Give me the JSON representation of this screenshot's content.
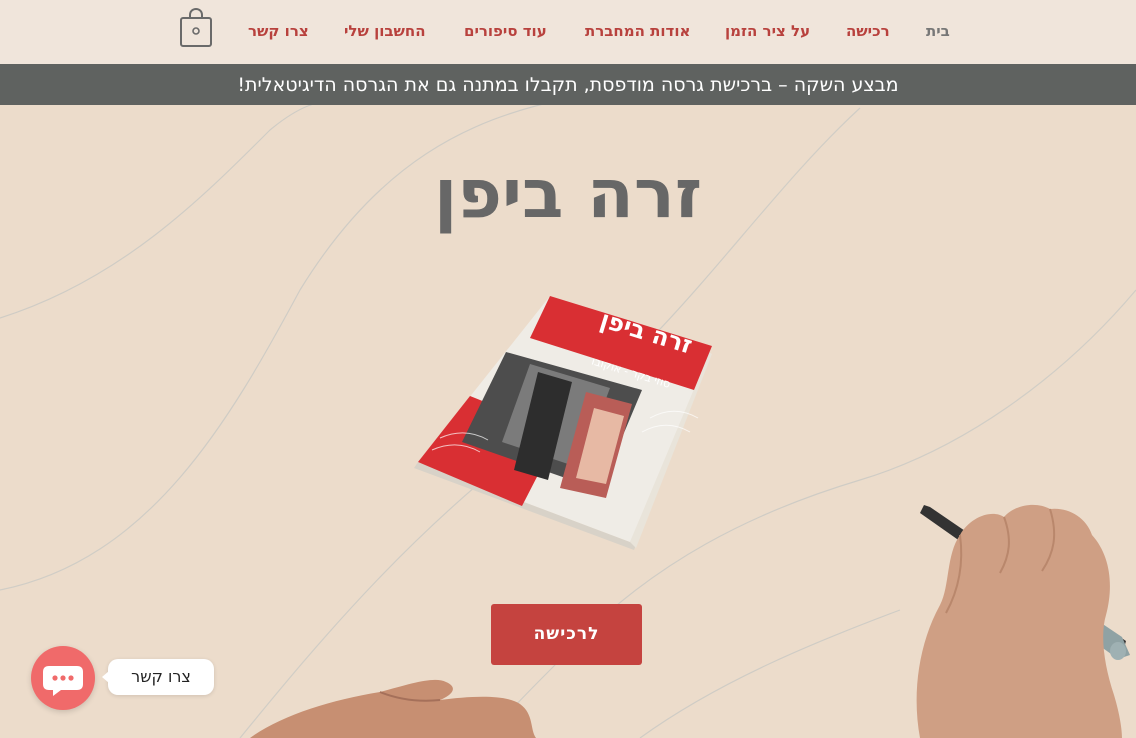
{
  "nav": {
    "home": "בית",
    "purchase": "רכישה",
    "about_time_painter": "על ציר הזמן",
    "about_author": "אודות המחברת",
    "more_stories": "עוד סיפורים",
    "my_account": "החשבון שלי",
    "contact": "צרו קשר"
  },
  "icons": {
    "cart": "shopping-bag-icon",
    "chat": "chat-bubble-icon"
  },
  "banner": {
    "text": "מבצע השקה – ברכישת גרסה מודפסת, תקבלו במתנה גם את הגרסה הדיגיטאלית!"
  },
  "hero": {
    "title": "זרה ביפן",
    "cta_label": "לרכישה"
  },
  "book_cover": {
    "title": "זרה ביפן",
    "author": "סוזי בקר - אוקובו"
  },
  "chat_widget": {
    "label": "צרו קשר"
  },
  "colors": {
    "accent": "#c5433f",
    "nav_link": "#b8413d",
    "header_bg": "#f0e5db",
    "banner_bg": "#5f6260",
    "page_bg": "#ecdccb",
    "title": "#676767",
    "chat": "#f06a6a"
  }
}
